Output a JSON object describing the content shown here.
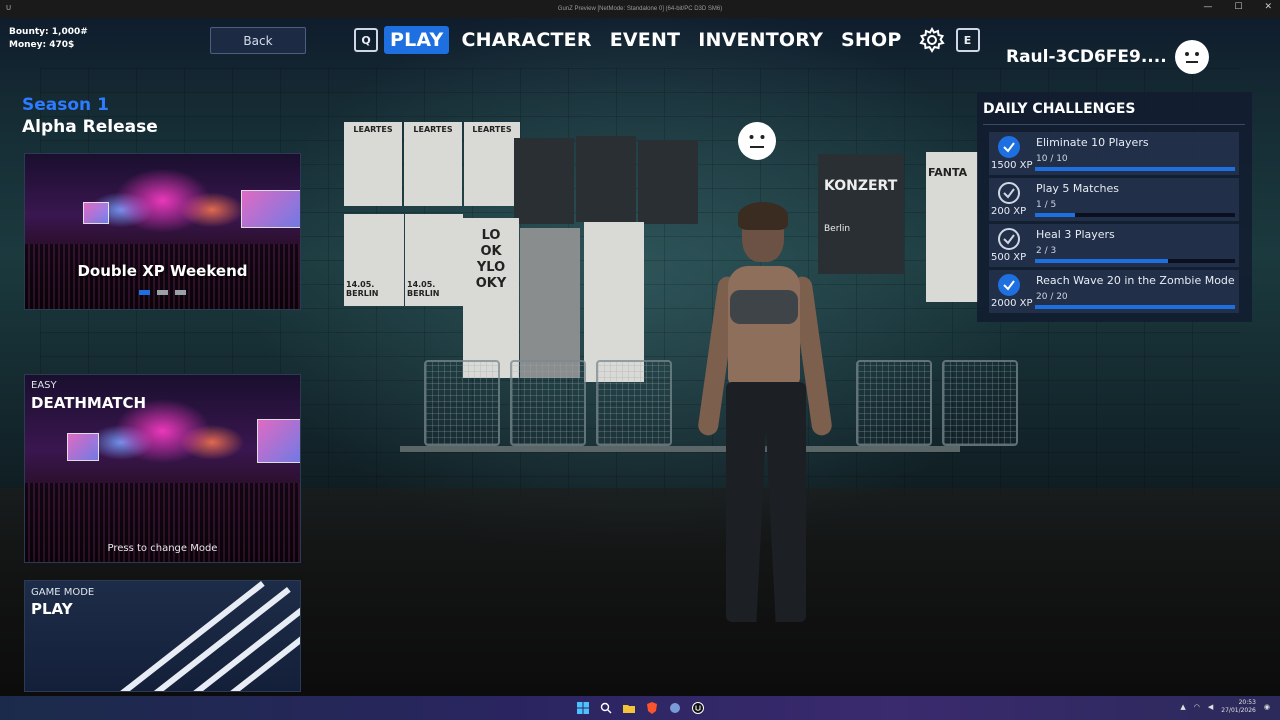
{
  "window": {
    "title": "GunZ Preview [NetMode: Standalone 0] (64-bit/PC D3D SM6)",
    "app_icon": "U",
    "minimize": "—",
    "maximize": "☐",
    "close": "✕"
  },
  "stats": {
    "bounty": "Bounty: 1,000#",
    "money": "Money: 470$"
  },
  "back_button": "Back",
  "nav": {
    "left_key": "Q",
    "right_key": "E",
    "tabs": [
      "PLAY",
      "CHARACTER",
      "EVENT",
      "INVENTORY",
      "SHOP"
    ],
    "active_tab": "PLAY"
  },
  "user": {
    "name": "Raul-3CD6FE9...."
  },
  "season": {
    "title": "Season 1",
    "subtitle": "Alpha Release"
  },
  "promo": {
    "title": "Double XP Weekend",
    "dots": 3,
    "active_dot": 0
  },
  "mode": {
    "difficulty": "EASY",
    "name": "DEATHMATCH",
    "hint": "Press to change Mode"
  },
  "play_card": {
    "label": "GAME MODE",
    "action": "PLAY"
  },
  "daily": {
    "title": "DAILY CHALLENGES",
    "challenges": [
      {
        "name": "Eliminate 10 Players",
        "progress": "10 / 10",
        "xp": "1500 XP",
        "done": true,
        "ratio": 1.0
      },
      {
        "name": "Play 5 Matches",
        "progress": "1 / 5",
        "xp": "200 XP",
        "done": false,
        "ratio": 0.2
      },
      {
        "name": "Heal 3 Players",
        "progress": "2 / 3",
        "xp": "500 XP",
        "done": false,
        "ratio": 0.667
      },
      {
        "name": "Reach Wave 20 in the Zombie Mode",
        "progress": "20 / 20",
        "xp": "2000 XP",
        "done": true,
        "ratio": 1.0
      }
    ]
  },
  "scene": {
    "posters": [
      "LEARTES",
      "LEARTES",
      "LEARTES",
      "KONZERT",
      "Berlin",
      "FANTA",
      "14.05. BERLIN",
      "14.05. BERLIN",
      "LO OK YLO OKY"
    ]
  },
  "taskbar": {
    "icons": [
      "windows-icon",
      "search-icon",
      "folder-icon",
      "browser-icon",
      "app-icon",
      "unreal-icon"
    ],
    "time": "20:53",
    "date": "27/01/2026"
  },
  "colors": {
    "accent": "#1e6fe0",
    "season": "#2d7cff"
  }
}
